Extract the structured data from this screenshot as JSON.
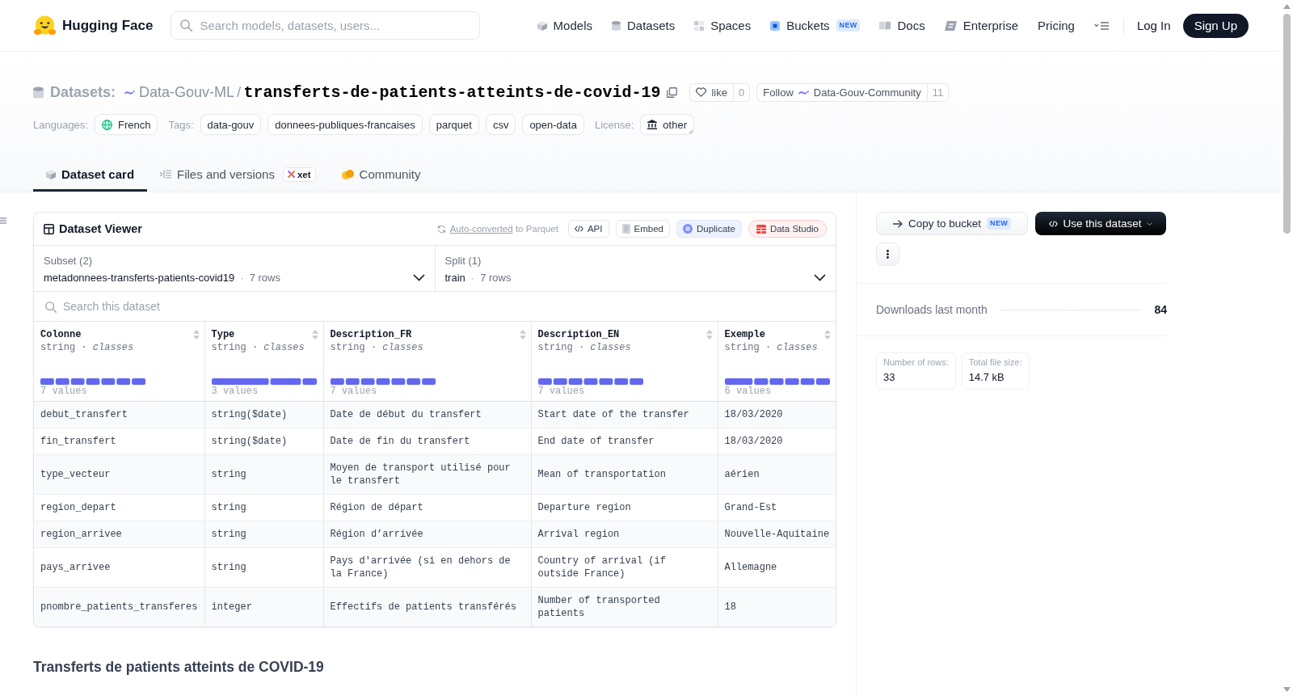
{
  "header": {
    "brand": "Hugging Face",
    "search": {
      "placeholder": "Search models, datasets, users..."
    },
    "nav": [
      {
        "label": "Models",
        "kind": "models"
      },
      {
        "label": "Datasets",
        "kind": "datasets"
      },
      {
        "label": "Spaces",
        "kind": "spaces"
      },
      {
        "label": "Buckets",
        "kind": "buckets",
        "badge": "NEW"
      },
      {
        "label": "Docs",
        "kind": "docs"
      },
      {
        "label": "Enterprise",
        "kind": "enterprise"
      },
      {
        "label": "Pricing",
        "kind": "pricing"
      }
    ],
    "log_in": "Log In",
    "sign_up": "Sign Up"
  },
  "repo": {
    "type": "Datasets:",
    "owner": "Data-Gouv-ML",
    "separator": "/",
    "name": "transferts-de-patients-atteints-de-covid-19",
    "like": {
      "label": "like",
      "count": "0"
    },
    "follow": {
      "label": "Follow",
      "org": "Data-Gouv-Community",
      "count": "11"
    },
    "tag_groups": [
      {
        "label": "Languages:",
        "tags": [
          {
            "text": "French",
            "kind": "language"
          }
        ]
      },
      {
        "label": "Tags:",
        "tags": [
          {
            "text": "data-gouv",
            "kind": "tag"
          },
          {
            "text": "donnees-publiques-francaises",
            "kind": "tag"
          },
          {
            "text": "parquet",
            "kind": "tag"
          },
          {
            "text": "csv",
            "kind": "tag"
          },
          {
            "text": "open-data",
            "kind": "tag"
          }
        ]
      },
      {
        "label": "License:",
        "tags": [
          {
            "text": "other",
            "kind": "license"
          }
        ]
      }
    ]
  },
  "tabs": [
    {
      "label": "Dataset card",
      "kind": "card",
      "selected": true
    },
    {
      "label": "Files and versions",
      "kind": "files",
      "badge": "xet",
      "selected": false
    },
    {
      "label": "Community",
      "kind": "community",
      "selected": false
    }
  ],
  "viewer": {
    "title": "Dataset Viewer",
    "conversion_note": {
      "link": "Auto-converted",
      "text": "to Parquet"
    },
    "actions": [
      {
        "label": "API",
        "kind": "api"
      },
      {
        "label": "Embed",
        "kind": "embed"
      },
      {
        "label": "Duplicate",
        "kind": "duplicate"
      },
      {
        "label": "Data Studio",
        "kind": "studio"
      }
    ],
    "selectors": [
      {
        "label": "Subset (2)",
        "value": "metadonnees-transferts-patients-covid19",
        "separator": "·",
        "count": "7 rows"
      },
      {
        "label": "Split (1)",
        "value": "train",
        "separator": "·",
        "count": "7 rows"
      }
    ],
    "search": {
      "placeholder": "Search this dataset"
    },
    "table": {
      "columns": [
        {
          "name": "Colonne",
          "type": "string · *classes*",
          "values": "7 values"
        },
        {
          "name": "Type",
          "type": "string · *classes*",
          "values": "3 values"
        },
        {
          "name": "Description_FR",
          "type": "string · *classes*",
          "values": "7 values"
        },
        {
          "name": "Description_EN",
          "type": "string · *classes*",
          "values": "7 values"
        },
        {
          "name": "Exemple",
          "type": "string · *classes*",
          "values": "6 values"
        }
      ],
      "rows": [
        [
          "debut_transfert",
          "string($date)",
          "Date de début du transfert",
          "Start date of the transfer",
          "18/03/2020"
        ],
        [
          "fin_transfert",
          "string($date)",
          "Date de fin du transfert",
          "End date of transfer",
          "18/03/2020"
        ],
        [
          "type_vecteur",
          "string",
          "Moyen de transport utilisé pour le transfert",
          "Mean of transportation",
          "aérien"
        ],
        [
          "region_depart",
          "string",
          "Région de départ",
          "Departure region",
          "Grand-Est"
        ],
        [
          "region_arrivee",
          "string",
          "Région d’arrivée",
          "Arrival region",
          "Nouvelle-Aquitaine"
        ],
        [
          "pays_arrivee",
          "string",
          "Pays d'arrivée (si en dehors de la France)",
          "Country of arrival (if outside France)",
          "Allemagne"
        ],
        [
          "pnombre_patients_transferes",
          "integer",
          "Effectifs de patients transférés",
          "Number of transported patients",
          "18"
        ]
      ]
    }
  },
  "sidebar": {
    "actions": [
      {
        "label": "Copy to bucket",
        "kind": "copy",
        "badge": "NEW"
      },
      {
        "label": "Use this dataset",
        "kind": "use"
      }
    ],
    "downloads": {
      "label": "Downloads last month",
      "value": "84"
    },
    "stats": [
      {
        "label": "Number of rows:",
        "value": "33"
      },
      {
        "label": "Total file size:",
        "value": "14.7 kB"
      }
    ]
  },
  "card": {
    "heading": "Transferts de patients atteints de COVID-19"
  }
}
